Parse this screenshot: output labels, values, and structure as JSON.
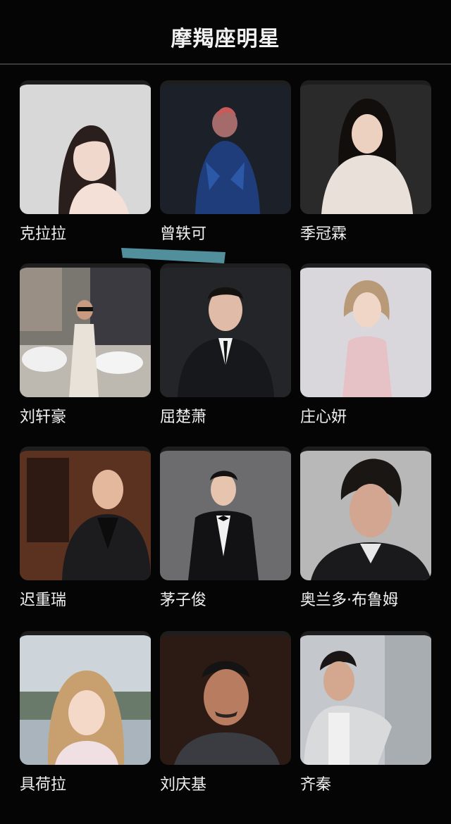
{
  "header": {
    "title": "摩羯座明星"
  },
  "celebrities": [
    {
      "name": "克拉拉"
    },
    {
      "name": "曾轶可"
    },
    {
      "name": "季冠霖"
    },
    {
      "name": "刘轩豪"
    },
    {
      "name": "屈楚萧"
    },
    {
      "name": "庄心妍"
    },
    {
      "name": "迟重瑞"
    },
    {
      "name": "茅子俊"
    },
    {
      "name": "奥兰多·布鲁姆"
    },
    {
      "name": "具荷拉"
    },
    {
      "name": "刘庆基"
    },
    {
      "name": "齐秦"
    }
  ],
  "colors": {
    "background": "#050505",
    "text": "#f0f0f0",
    "divider": "#3a3a3a",
    "scribble": "#5fa8b8"
  }
}
